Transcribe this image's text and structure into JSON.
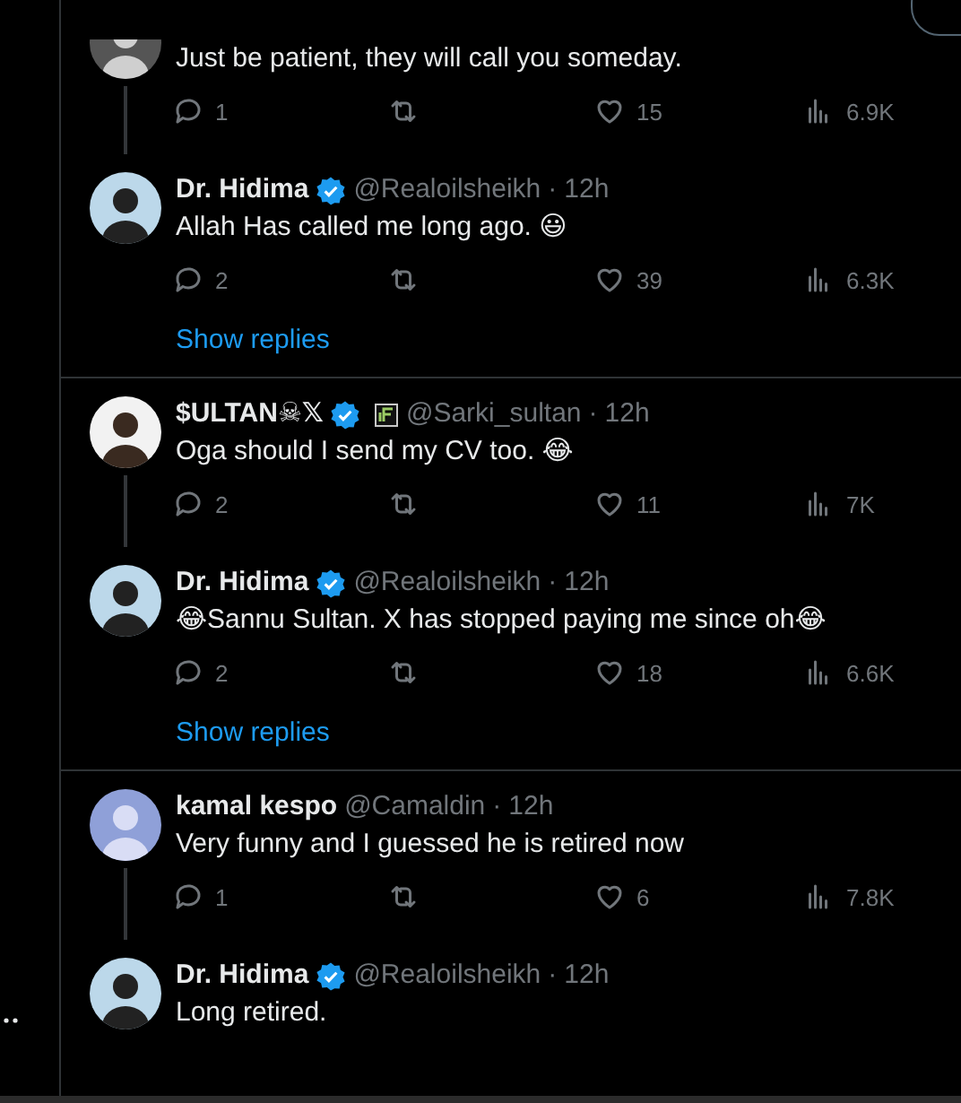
{
  "threads": [
    {
      "tweets": [
        {
          "verified": false,
          "affiliate": false,
          "text": "Just be patient, they will call you someday.",
          "avatar_cut": true,
          "replies": "1",
          "likes": "15",
          "views": "6.9K"
        },
        {
          "name": "Dr. Hidima",
          "verified": true,
          "affiliate": false,
          "handle": "@Realoilsheikh",
          "separator": "·",
          "time": "12h",
          "text": "Allah Has called me long ago. 😃",
          "avatar_cut": false,
          "replies": "2",
          "likes": "39",
          "views": "6.3K"
        }
      ],
      "show_replies": "Show replies"
    },
    {
      "tweets": [
        {
          "name": "$ULTAN☠𝕏",
          "verified": true,
          "affiliate": true,
          "handle": "@Sarki_sultan",
          "separator": "·",
          "time": "12h",
          "text": "Oga should I send my CV too. 😂",
          "avatar_cut": false,
          "replies": "2",
          "likes": "11",
          "views": "7K"
        },
        {
          "name": "Dr. Hidima",
          "verified": true,
          "affiliate": false,
          "handle": "@Realoilsheikh",
          "separator": "·",
          "time": "12h",
          "text": "😂Sannu Sultan. X has stopped paying me since oh😂",
          "avatar_cut": false,
          "replies": "2",
          "likes": "18",
          "views": "6.6K"
        }
      ],
      "show_replies": "Show replies"
    },
    {
      "tweets": [
        {
          "name": "kamal kespo",
          "verified": false,
          "affiliate": false,
          "handle": "@Camaldin",
          "separator": "·",
          "time": "12h",
          "text": "Very funny and I guessed he is retired now",
          "avatar_cut": false,
          "replies": "1",
          "likes": "6",
          "views": "7.8K"
        },
        {
          "name": "Dr. Hidima",
          "verified": true,
          "affiliate": false,
          "handle": "@Realoilsheikh",
          "separator": "·",
          "time": "12h",
          "text": "Long retired.",
          "avatar_cut": false
        }
      ]
    }
  ]
}
